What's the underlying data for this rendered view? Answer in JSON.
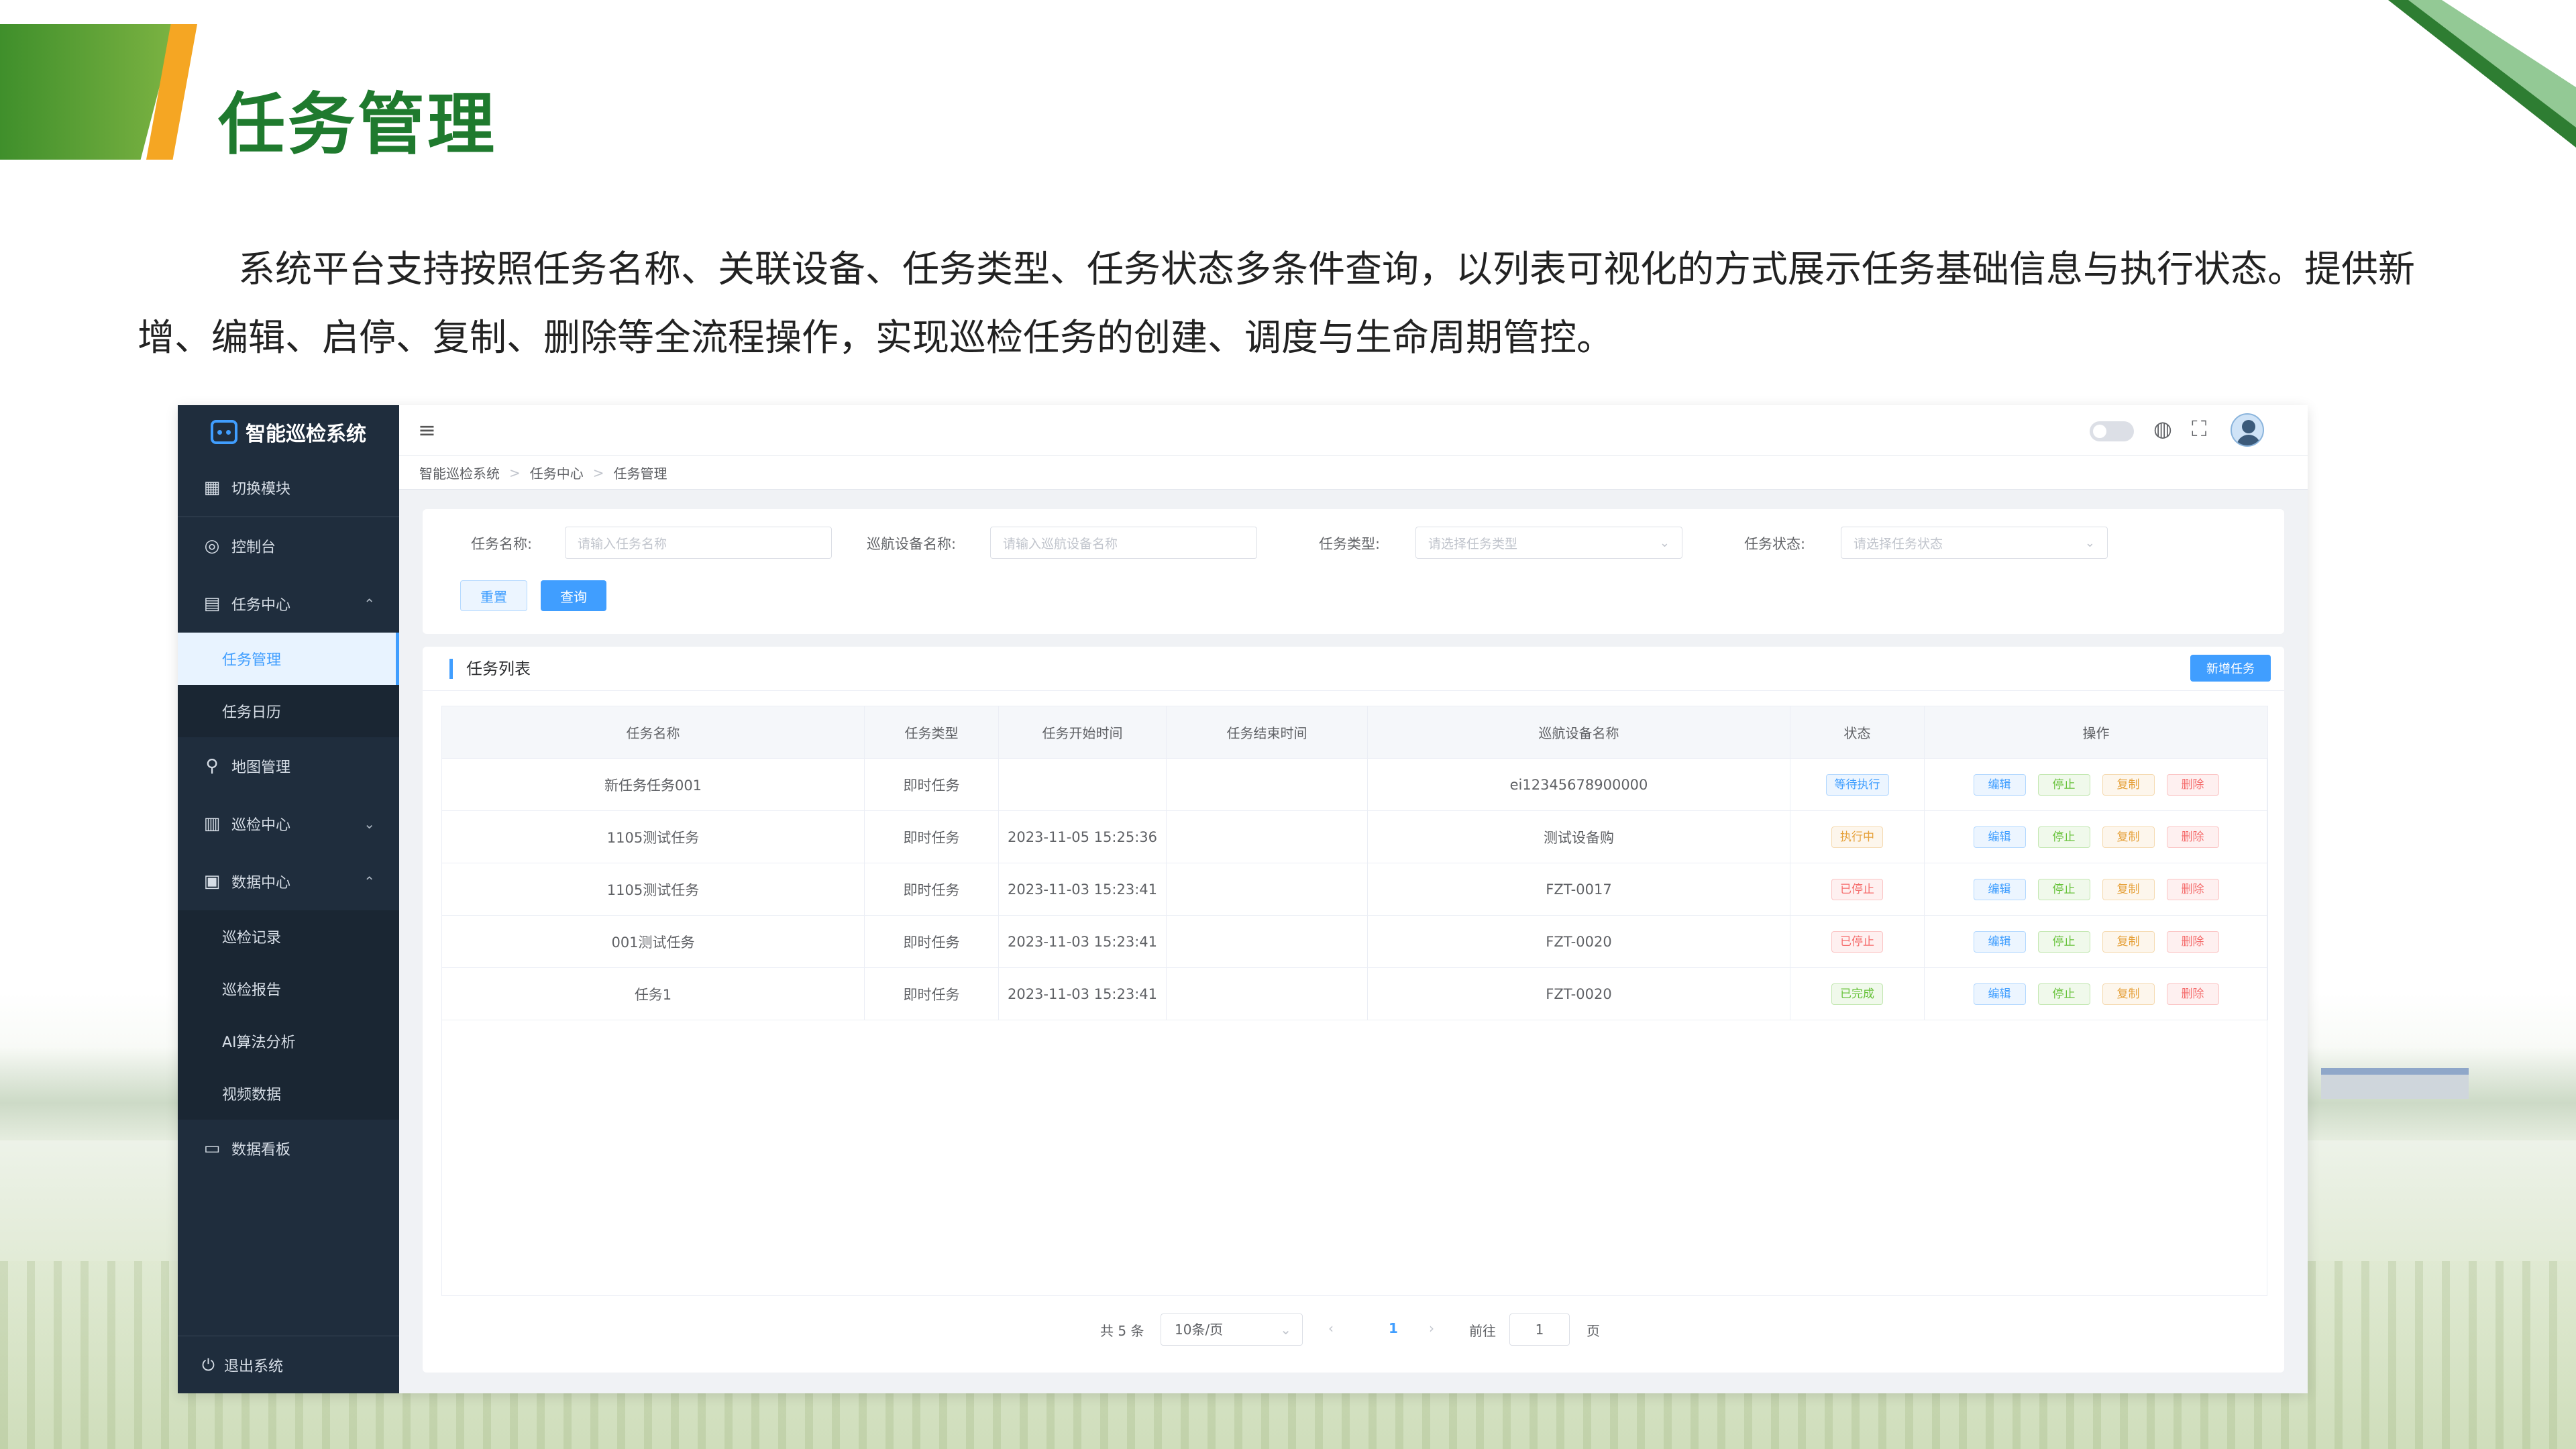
{
  "slide": {
    "title": "任务管理",
    "description": "系统平台支持按照任务名称、关联设备、任务类型、任务状态多条件查询，以列表可视化的方式展示任务基础信息与执行状态。提供新增、编辑、启停、复制、删除等全流程操作，实现巡检任务的创建、调度与生命周期管控。"
  },
  "sidebar": {
    "logo": "智能巡检系统",
    "switch_module": "切换模块",
    "console": "控制台",
    "task_center": "任务中心",
    "task_manage": "任务管理",
    "task_calendar": "任务日历",
    "map_manage": "地图管理",
    "patrol_center": "巡检中心",
    "data_center": "数据中心",
    "patrol_record": "巡检记录",
    "patrol_report": "巡检报告",
    "ai_analysis": "AI算法分析",
    "video_data": "视频数据",
    "data_board": "数据看板",
    "logout": "退出系统"
  },
  "breadcrumb": [
    "智能巡检系统",
    "任务中心",
    "任务管理"
  ],
  "search": {
    "task_name_label": "任务名称:",
    "task_name_placeholder": "请输入任务名称",
    "device_label": "巡航设备名称:",
    "device_placeholder": "请输入巡航设备名称",
    "type_label": "任务类型:",
    "type_placeholder": "请选择任务类型",
    "status_label": "任务状态:",
    "status_placeholder": "请选择任务状态",
    "reset": "重置",
    "query": "查询"
  },
  "list": {
    "title": "任务列表",
    "add_button": "新增任务",
    "columns": [
      "任务名称",
      "任务类型",
      "任务开始时间",
      "任务结束时间",
      "巡航设备名称",
      "状态",
      "操作"
    ],
    "rows": [
      {
        "name": "新任务任务001",
        "type": "即时任务",
        "start": "",
        "end": "",
        "device": "ei12345678900000",
        "status": "等待执行"
      },
      {
        "name": "1105测试任务",
        "type": "即时任务",
        "start": "2023-11-05 15:25:36",
        "end": "",
        "device": "测试设备购",
        "status": "执行中"
      },
      {
        "name": "1105测试任务",
        "type": "即时任务",
        "start": "2023-11-03 15:23:41",
        "end": "",
        "device": "FZT-0017",
        "status": "已停止"
      },
      {
        "name": "001测试任务",
        "type": "即时任务",
        "start": "2023-11-03 15:23:41",
        "end": "",
        "device": "FZT-0020",
        "status": "已停止"
      },
      {
        "name": "任务1",
        "type": "即时任务",
        "start": "2023-11-03 15:23:41",
        "end": "",
        "device": "FZT-0020",
        "status": "已完成"
      }
    ],
    "ops": {
      "edit": "编辑",
      "stop": "停止",
      "copy": "复制",
      "delete": "删除"
    }
  },
  "pagination": {
    "total": "共 5 条",
    "page_size": "10条/页",
    "current": "1",
    "goto_label": "前往",
    "goto_value": "1",
    "page_unit": "页"
  },
  "colors": {
    "accent": "#409eff",
    "sidebar_bg": "#1f2d3d",
    "title_green": "#1f7a2e"
  }
}
